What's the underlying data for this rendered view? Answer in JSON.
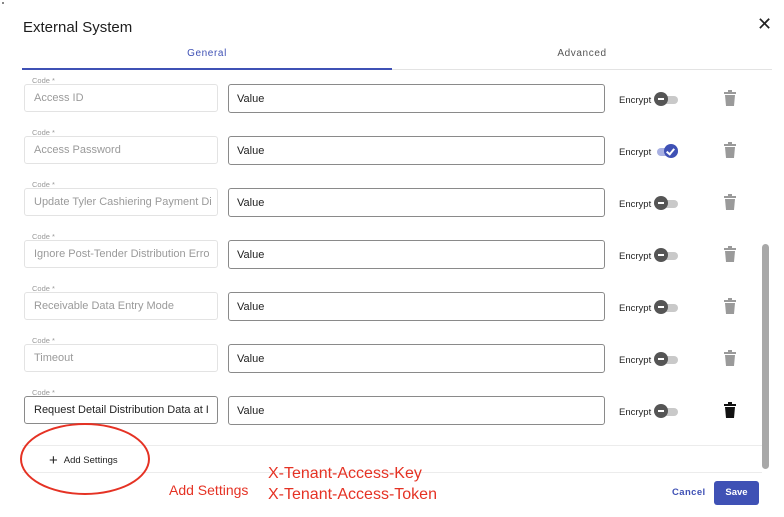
{
  "dialog": {
    "title": "External System",
    "close_glyph": "✕"
  },
  "tabs": [
    {
      "label": "General",
      "active": true
    },
    {
      "label": "Advanced",
      "active": false
    }
  ],
  "settings": [
    {
      "code_label": "Code *",
      "code": "Access ID",
      "value": "Value",
      "encrypt_label": "Encrypt",
      "encrypted": false
    },
    {
      "code_label": "Code *",
      "code": "Access Password",
      "value": "Value",
      "encrypt_label": "Encrypt",
      "encrypted": true
    },
    {
      "code_label": "Code *",
      "code": "Update Tyler Cashiering Payment Di",
      "value": "Value",
      "encrypt_label": "Encrypt",
      "encrypted": false
    },
    {
      "code_label": "Code *",
      "code": "Ignore Post-Tender Distribution Erro",
      "value": "Value",
      "encrypt_label": "Encrypt",
      "encrypted": false
    },
    {
      "code_label": "Code *",
      "code": "Receivable Data Entry Mode",
      "value": "Value",
      "encrypt_label": "Encrypt",
      "encrypted": false
    },
    {
      "code_label": "Code *",
      "code": "Timeout",
      "value": "Value",
      "encrypt_label": "Encrypt",
      "encrypted": false
    },
    {
      "code_label": "Code *",
      "code": "Request Detail Distribution Data at I",
      "value": "Value",
      "encrypt_label": "Encrypt",
      "encrypted": false
    }
  ],
  "add_settings": {
    "label": "Add Settings",
    "icon": "plus-icon"
  },
  "annotation": {
    "callout": "Add Settings",
    "key_line_1": "X-Tenant-Access-Key",
    "key_line_2": "X-Tenant-Access-Token"
  },
  "footer": {
    "cancel_label": "Cancel",
    "save_label": "Save"
  },
  "colors": {
    "accent": "#3f51b5",
    "annotation": "#e53224"
  }
}
